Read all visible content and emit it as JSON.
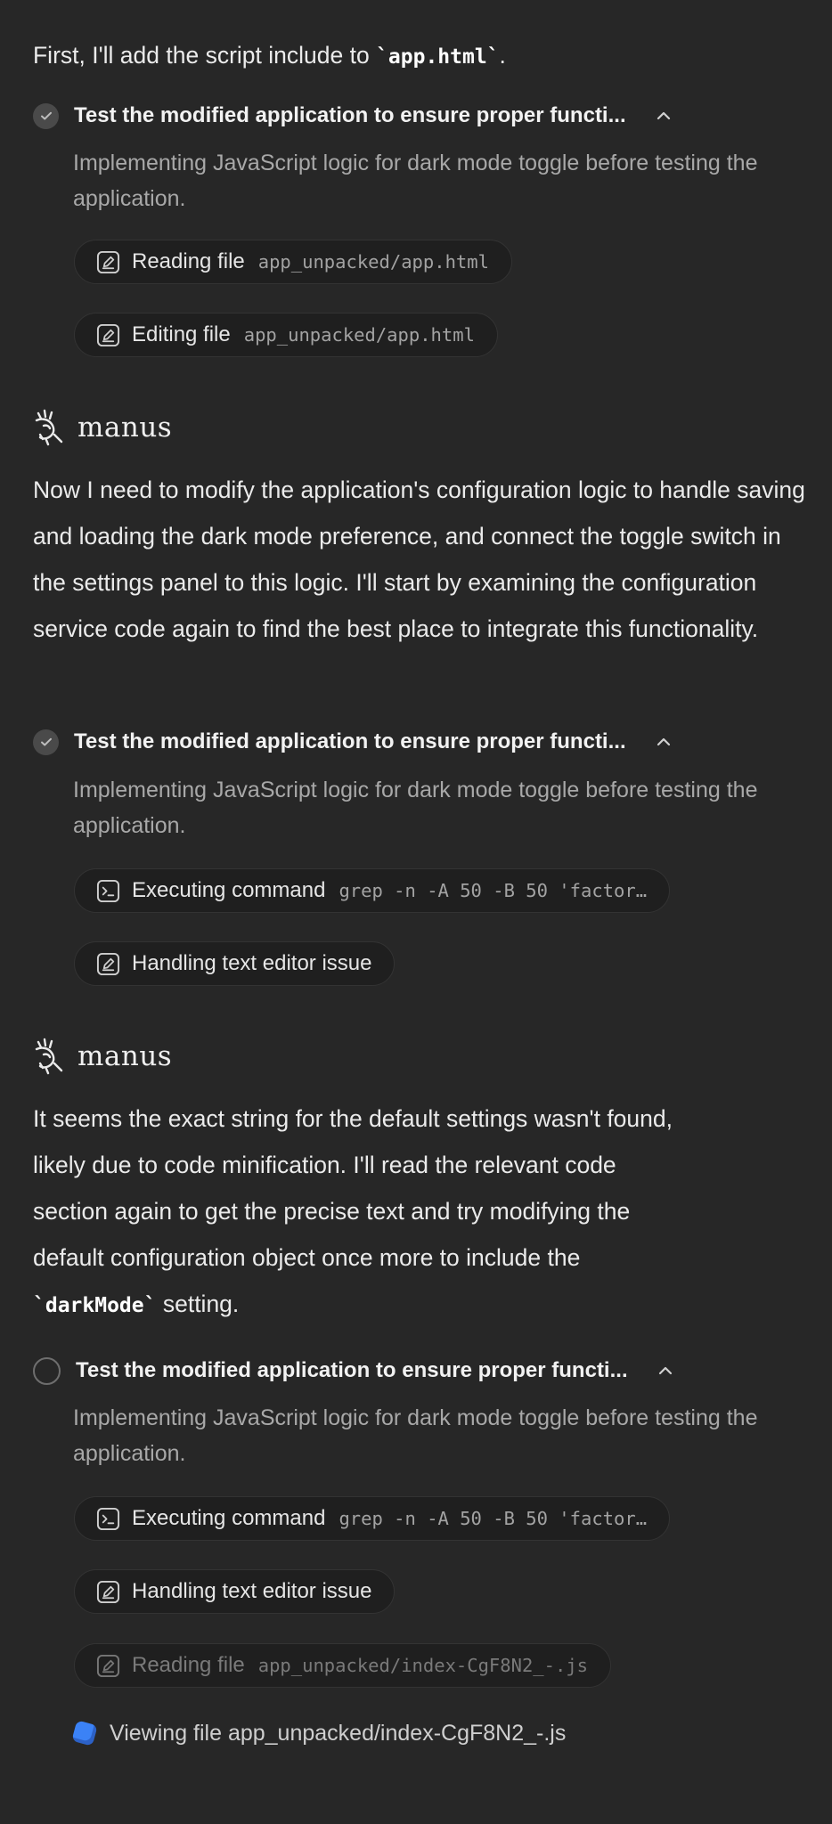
{
  "messages": [
    {
      "before": "First, I'll add the script include to ",
      "code": "`app.html`",
      "after": "."
    },
    {
      "text": "Now I need to modify the application's configuration logic to handle saving and loading the dark mode preference, and connect the toggle switch in the settings panel to this logic. I'll start by examining the configuration service code again to find the best place to integrate this functionality."
    },
    {
      "line1": "It seems the exact string for the default settings wasn't found,",
      "line2": "likely due to code minification. I'll read the relevant code",
      "line3": "section again to get the precise text and try modifying the",
      "line4": "default configuration object once more to include the",
      "code": "`darkMode`",
      "after": " setting."
    }
  ],
  "brand": {
    "name": "manus",
    "icon": "manus-hand-icon"
  },
  "tasks": [
    {
      "title": "Test the modified application to ensure proper functi...",
      "status": "done",
      "description": "Implementing JavaScript logic for dark mode toggle before testing the application.",
      "steps": [
        {
          "icon": "edit-icon",
          "label": "Reading file",
          "arg": "app_unpacked/app.html"
        },
        {
          "icon": "edit-icon",
          "label": "Editing file",
          "arg": "app_unpacked/app.html"
        }
      ]
    },
    {
      "title": "Test the modified application to ensure proper functi...",
      "status": "done",
      "description": "Implementing JavaScript logic for dark mode toggle before testing the application.",
      "steps": [
        {
          "icon": "terminal-icon",
          "label": "Executing command",
          "arg": "grep -n -A 50 -B 50 'factor…"
        },
        {
          "icon": "edit-icon",
          "label": "Handling text editor issue",
          "arg": ""
        }
      ]
    },
    {
      "title": "Test the modified application to ensure proper functi...",
      "status": "in-progress",
      "description": "Implementing JavaScript logic for dark mode toggle before testing the application.",
      "steps": [
        {
          "icon": "terminal-icon",
          "label": "Executing command",
          "arg": "grep -n -A 50 -B 50 'factor…"
        },
        {
          "icon": "edit-icon",
          "label": "Handling text editor issue",
          "arg": ""
        },
        {
          "icon": "edit-icon",
          "label": "Reading file",
          "arg": "app_unpacked/index-CgF8N2_-.js"
        }
      ],
      "current": {
        "icon": "viewing-icon",
        "label": "Viewing file app_unpacked/index-CgF8N2_-.js"
      }
    }
  ],
  "colors": {
    "background": "#272727",
    "pill": "#1f1f1f",
    "accent": "#3b82f6"
  }
}
